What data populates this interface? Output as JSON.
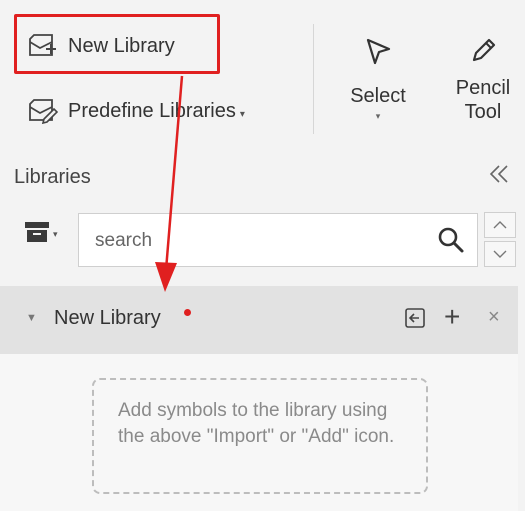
{
  "toolbar": {
    "new_library_label": "New Library",
    "predefine_libraries_label": "Predefine Libraries",
    "select_label": "Select",
    "pencil_line1": "Pencil",
    "pencil_line2": "Tool"
  },
  "libraries": {
    "title": "Libraries",
    "search_placeholder": "search",
    "library_name": "New Library",
    "empty_hint": "Add symbols to the library using the above \"Import\" or \"Add\" icon."
  },
  "annotation": {
    "highlight_color": "#e02020",
    "arrow_color": "#e02020"
  },
  "icons": [
    "new-library-icon",
    "predefine-libraries-icon",
    "select-arrow-icon",
    "pencil-icon",
    "collapse-double-chevron-icon",
    "archive-icon",
    "search-icon",
    "chevron-up-icon",
    "chevron-down-icon",
    "expand-triangle-icon",
    "import-icon",
    "add-icon",
    "close-icon"
  ]
}
